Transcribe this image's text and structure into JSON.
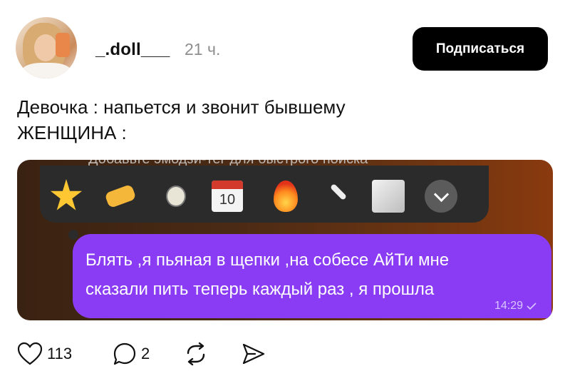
{
  "post": {
    "username": "_.doll___",
    "time": "21 ч.",
    "subscribe_label": "Подписаться",
    "caption_lines": [
      "Девочка : напьется и звонит бывшему",
      "ЖЕНЩИНА :"
    ]
  },
  "screenshot": {
    "hint": "Добавьте эмодзи-тег для быстрого поиска",
    "emoji": [
      "star",
      "writing-hand",
      "light-bulb",
      "calendar",
      "fire",
      "airplane",
      "notepad"
    ],
    "calendar_number": "10",
    "message_lines": [
      "Блять ,я пьяная в щепки ,на собесе АйТи мне",
      "сказали пить теперь  каждый раз , я прошла"
    ],
    "message_time": "14:29",
    "bubble_color": "#8a3cf5"
  },
  "actions": {
    "likes": "113",
    "comments": "2",
    "icons": [
      "heart-icon",
      "comment-icon",
      "repost-icon",
      "share-icon"
    ]
  }
}
